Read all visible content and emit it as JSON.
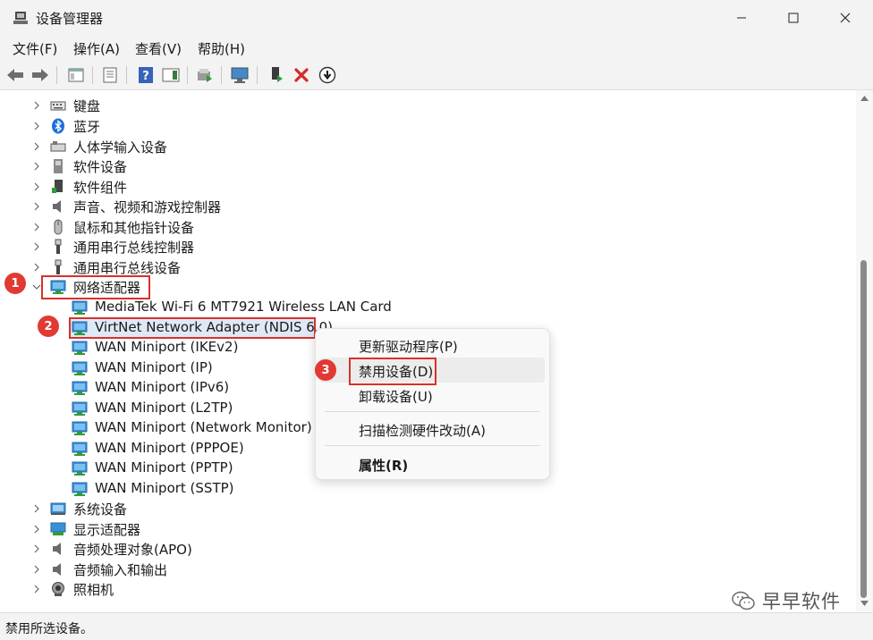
{
  "window": {
    "title": "设备管理器",
    "minimize_icon": "minimize-icon",
    "maximize_icon": "maximize-icon",
    "close_icon": "close-icon"
  },
  "menubar": {
    "file": "文件(F)",
    "action": "操作(A)",
    "view": "查看(V)",
    "help": "帮助(H)"
  },
  "toolbar": {
    "icons": [
      "back-arrow-icon",
      "forward-arrow-icon",
      "show-hide-console-tree-icon",
      "properties-icon",
      "help-icon",
      "action-pane-icon",
      "update-driver-icon",
      "scan-hardware-icon",
      "enable-device-icon",
      "uninstall-icon",
      "disable-device-icon"
    ]
  },
  "tree": {
    "items": [
      {
        "label": "键盘",
        "icon": "keyboard-icon",
        "expanded": false
      },
      {
        "label": "蓝牙",
        "icon": "bluetooth-icon",
        "expanded": false
      },
      {
        "label": "人体学输入设备",
        "icon": "hid-icon",
        "expanded": false
      },
      {
        "label": "软件设备",
        "icon": "software-device-icon",
        "expanded": false
      },
      {
        "label": "软件组件",
        "icon": "software-component-icon",
        "expanded": false
      },
      {
        "label": "声音、视频和游戏控制器",
        "icon": "speaker-icon",
        "expanded": false
      },
      {
        "label": "鼠标和其他指针设备",
        "icon": "mouse-icon",
        "expanded": false
      },
      {
        "label": "通用串行总线控制器",
        "icon": "usb-icon",
        "expanded": false
      },
      {
        "label": "通用串行总线设备",
        "icon": "usb-device-icon",
        "expanded": false
      },
      {
        "label": "网络适配器",
        "icon": "network-adapter-icon",
        "expanded": true
      }
    ],
    "network_children": [
      "MediaTek Wi-Fi 6 MT7921 Wireless LAN Card",
      "VirtNet Network Adapter (NDIS 6.0)",
      "WAN Miniport (IKEv2)",
      "WAN Miniport (IP)",
      "WAN Miniport (IPv6)",
      "WAN Miniport (L2TP)",
      "WAN Miniport (Network Monitor)",
      "WAN Miniport (PPPOE)",
      "WAN Miniport (PPTP)",
      "WAN Miniport (SSTP)"
    ],
    "items_after": [
      {
        "label": "系统设备",
        "icon": "system-device-icon"
      },
      {
        "label": "显示适配器",
        "icon": "display-adapter-icon"
      },
      {
        "label": "音频处理对象(APO)",
        "icon": "audio-apo-icon"
      },
      {
        "label": "音频输入和输出",
        "icon": "audio-io-icon"
      },
      {
        "label": "照相机",
        "icon": "camera-icon"
      }
    ]
  },
  "annotations": {
    "step1": "1",
    "step2": "2",
    "step3": "3"
  },
  "context_menu": {
    "update_driver": "更新驱动程序(P)",
    "disable_device": "禁用设备(D)",
    "uninstall_device": "卸载设备(U)",
    "scan_hardware": "扫描检测硬件改动(A)",
    "properties": "属性(R)"
  },
  "status": {
    "text": "禁用所选设备。"
  },
  "watermark": {
    "text": "早早软件"
  },
  "colors": {
    "highlight_red": "#d9302b",
    "badge_red": "#e03a33",
    "selection_blue": "#dfe9f5",
    "chrome_gray": "#f3f3f3"
  }
}
